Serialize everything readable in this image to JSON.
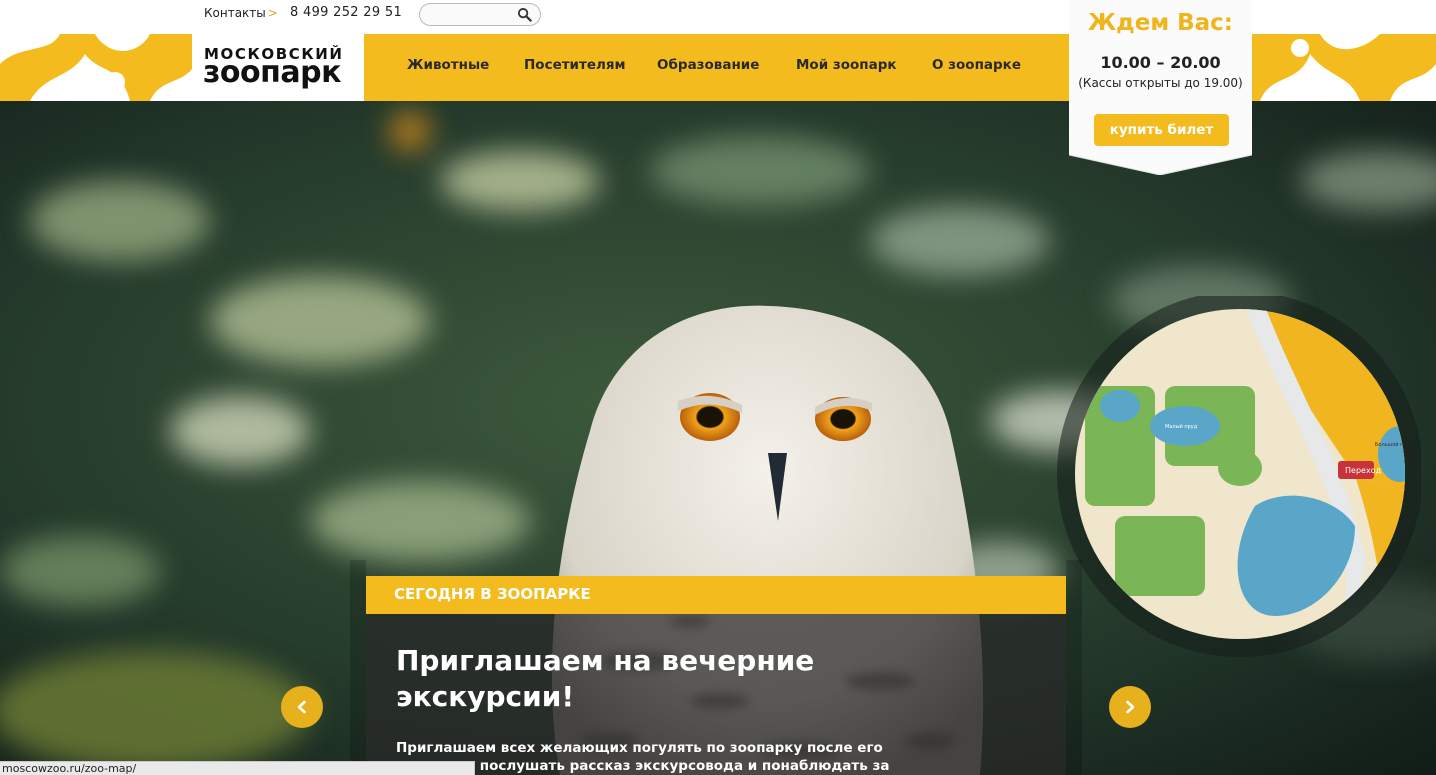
{
  "topbar": {
    "contacts_label": "Контакты",
    "contacts_arrow": ">",
    "phone": "8 499 252 29 51",
    "search_value": "",
    "search_icon": "search-icon"
  },
  "logo": {
    "line1": "МОСКОВСКИЙ",
    "line2": "зоопарк"
  },
  "nav": {
    "items": [
      {
        "label": "Животные"
      },
      {
        "label": "Посетителям"
      },
      {
        "label": "Образование"
      },
      {
        "label": "Мой зоопарк"
      },
      {
        "label": "О зоопарке"
      }
    ]
  },
  "visit": {
    "title": "Ждем Вас:",
    "hours": "10.00 – 20.00",
    "note": "(Кассы открыты до 19.00)",
    "buy_label": "купить билет"
  },
  "news": {
    "section_label": "СЕГОДНЯ В ЗООПАРКЕ",
    "title": "Приглашаем на вечерние экскурсии!",
    "text": "Приглашаем всех желающих погулять по зоопарку после его закрытия, послушать рассказ экскурсовода и понаблюдать за животными, когда их"
  },
  "map": {
    "labels": [
      "Переход",
      "Большой пруд",
      "Малый пруд"
    ]
  },
  "status_bar": {
    "url": "moscowzoo.ru/zoo-map/"
  },
  "colors": {
    "brand_yellow": "#f4bb1e",
    "accent_orange": "#e8a319",
    "text_dark": "#222222"
  }
}
